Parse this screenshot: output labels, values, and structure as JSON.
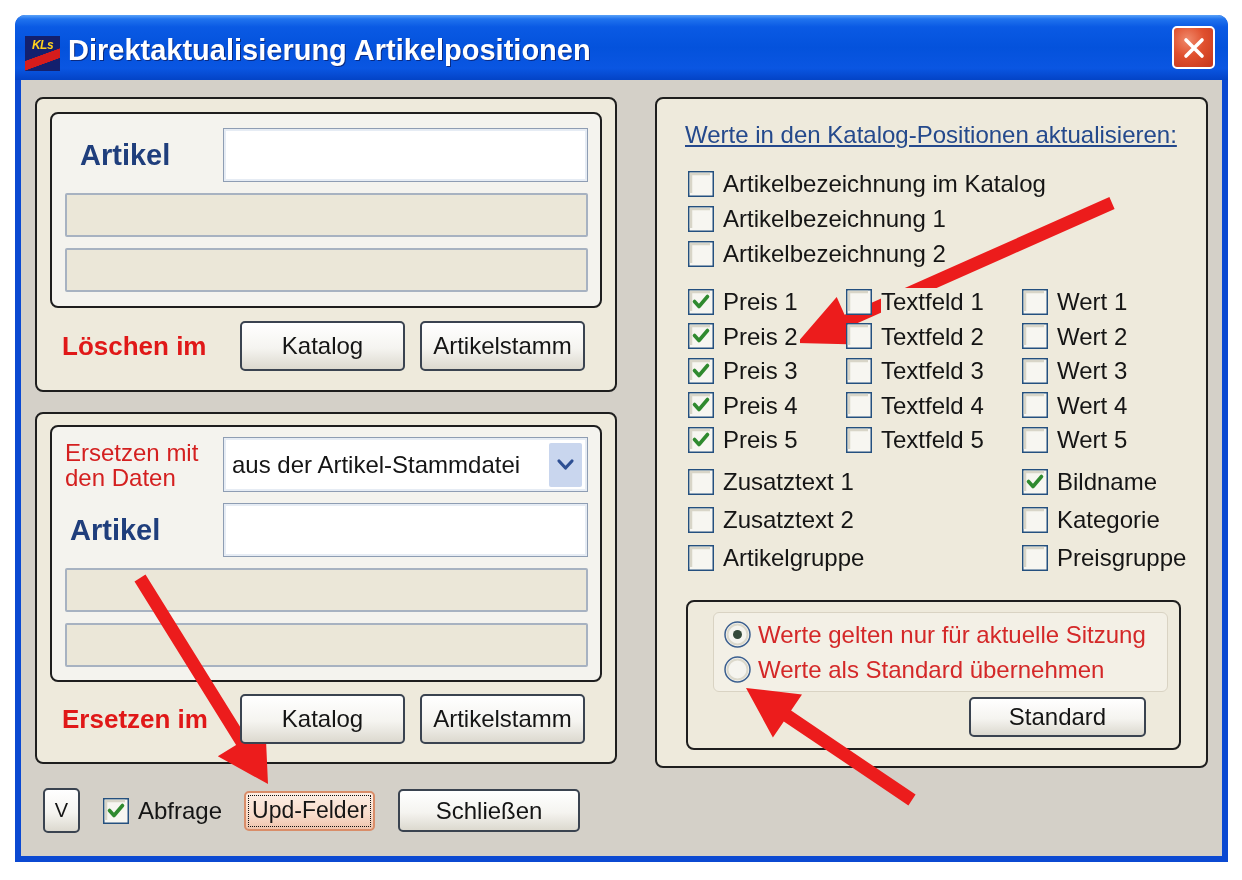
{
  "window": {
    "logo": "KLs",
    "title": "Direktaktualisierung Artikelpositionen"
  },
  "delete_panel": {
    "article_label": "Artikel",
    "action_label": "Löschen im",
    "buttons": [
      {
        "label": "Katalog"
      },
      {
        "label": "Artikelstamm"
      }
    ]
  },
  "replace_panel": {
    "source_label": "Ersetzen mit den Daten",
    "source_dropdown": {
      "value": "aus der Artikel-Stammdatei"
    },
    "article_label": "Artikel",
    "action_label": "Ersetzen im",
    "buttons": [
      {
        "label": "Katalog"
      },
      {
        "label": "Artikelstamm"
      }
    ]
  },
  "footer": {
    "items": [
      {
        "kind": "button",
        "label": "V",
        "focused": false
      },
      {
        "kind": "checkbox",
        "label": "Abfrage",
        "checked": true
      },
      {
        "kind": "button",
        "label": "Upd-Felder",
        "focused": true
      },
      {
        "kind": "button",
        "label": "Schließen",
        "focused": false
      }
    ]
  },
  "update_panel": {
    "heading": "Werte in den Katalog-Positionen aktualisieren:",
    "name_fields": [
      {
        "label": "Artikelbezeichnung im Katalog",
        "checked": false
      },
      {
        "label": "Artikelbezeichnung 1",
        "checked": false
      },
      {
        "label": "Artikelbezeichnung 2",
        "checked": false
      }
    ],
    "field_columns": [
      {
        "items": [
          {
            "label": "Preis 1",
            "checked": true
          },
          {
            "label": "Preis 2",
            "checked": true
          },
          {
            "label": "Preis 3",
            "checked": true
          },
          {
            "label": "Preis 4",
            "checked": true
          },
          {
            "label": "Preis 5",
            "checked": true
          }
        ]
      },
      {
        "items": [
          {
            "label": "Textfeld 1",
            "checked": false
          },
          {
            "label": "Textfeld 2",
            "checked": false
          },
          {
            "label": "Textfeld 3",
            "checked": false
          },
          {
            "label": "Textfeld 4",
            "checked": false
          },
          {
            "label": "Textfeld 5",
            "checked": false
          }
        ]
      },
      {
        "items": [
          {
            "label": "Wert 1",
            "checked": false
          },
          {
            "label": "Wert 2",
            "checked": false
          },
          {
            "label": "Wert 3",
            "checked": false
          },
          {
            "label": "Wert 4",
            "checked": false
          },
          {
            "label": "Wert 5",
            "checked": false
          }
        ]
      }
    ],
    "extra_columns": [
      {
        "items": [
          {
            "label": "Zusatztext 1",
            "checked": false
          },
          {
            "label": "Zusatztext 2",
            "checked": false
          },
          {
            "label": "Artikelgruppe",
            "checked": false
          }
        ]
      },
      {
        "items": [
          {
            "label": "Bildname",
            "checked": true
          },
          {
            "label": "Kategorie",
            "checked": false
          },
          {
            "label": "Preisgruppe",
            "checked": false
          }
        ]
      }
    ],
    "scope": {
      "options": [
        {
          "label": "Werte gelten nur für aktuelle Sitzung",
          "selected": true
        },
        {
          "label": "Werte als Standard übernehmen",
          "selected": false
        }
      ],
      "button": "Standard"
    }
  }
}
